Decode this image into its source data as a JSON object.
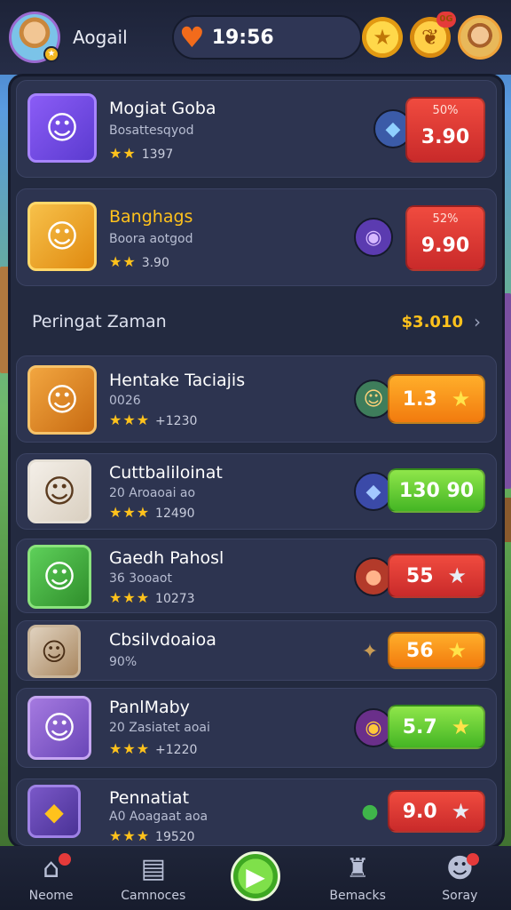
{
  "topbar": {
    "player_name": "Aogail",
    "timer": "19:56",
    "gift_badge": "0G"
  },
  "section": {
    "title": "Peringat Zaman",
    "value": "$3.010"
  },
  "items": [
    {
      "title": "Mogiat Goba",
      "sub": "Bosattesqyod",
      "rating": "1397",
      "price_top": "50%",
      "price": "3.90",
      "price_color": "red"
    },
    {
      "title": "Banghags",
      "sub": "Boora aotgod",
      "rating": "3.90",
      "price_top": "52%",
      "price": "9.90",
      "price_color": "red"
    },
    {
      "title": "Hentake Taciajis",
      "sub": "0026",
      "rating": "+1230",
      "price_top": "",
      "price": "1.3",
      "price_color": "orange"
    },
    {
      "title": "Cuttbaliloinat",
      "sub": "20 Aroaoai ao",
      "rating": "12490",
      "price_top": "",
      "price": "130 90",
      "price_color": "green"
    },
    {
      "title": "Gaedh Pahosl",
      "sub": "36 3ooaot",
      "rating": "10273",
      "price_top": "",
      "price": "55",
      "price_color": "red"
    },
    {
      "title": "Cbsilvdoaioa",
      "sub": "90%",
      "rating": "",
      "price_top": "",
      "price": "56",
      "price_color": "orange"
    },
    {
      "title": "PanlMaby",
      "sub": "20 Zasiatet aoai",
      "rating": "+1220",
      "price_top": "",
      "price": "5.7",
      "price_color": "green"
    },
    {
      "title": "Pennatiat",
      "sub": "A0 Aoagaat aoa",
      "rating": "19520",
      "price_top": "",
      "price": "9.0",
      "price_color": "red"
    }
  ],
  "nav": [
    {
      "label": "Neome"
    },
    {
      "label": "Camnoces"
    },
    {
      "label": ""
    },
    {
      "label": "Bemacks"
    },
    {
      "label": "Soray"
    }
  ]
}
